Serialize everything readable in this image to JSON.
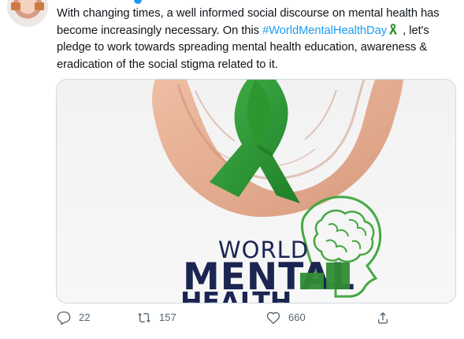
{
  "tweet": {
    "text_part1": "With changing times, a well informed social discourse on mental health has become increasingly necessary. On this ",
    "hashtag": "#WorldMentalHealthDay",
    "text_part2": " , let's pledge to work towards spreading mental health education, awareness & eradication of the social stigma related to it."
  },
  "media": {
    "title_top": "WORLD",
    "title_mid": "MENTAL",
    "title_bottom": "HEALTH"
  },
  "actions": {
    "reply_count": "22",
    "retweet_count": "157",
    "like_count": "660"
  },
  "colors": {
    "hashtag": "#1d9bf0",
    "ribbon": "#2a8f2a",
    "text": "#0f1419",
    "muted": "#536471",
    "navy": "#1b2551",
    "green": "#2f8b35"
  },
  "icons": {
    "reply": "reply-icon",
    "retweet": "retweet-icon",
    "like": "like-icon",
    "share": "share-icon",
    "ribbon": "green-ribbon-icon"
  }
}
